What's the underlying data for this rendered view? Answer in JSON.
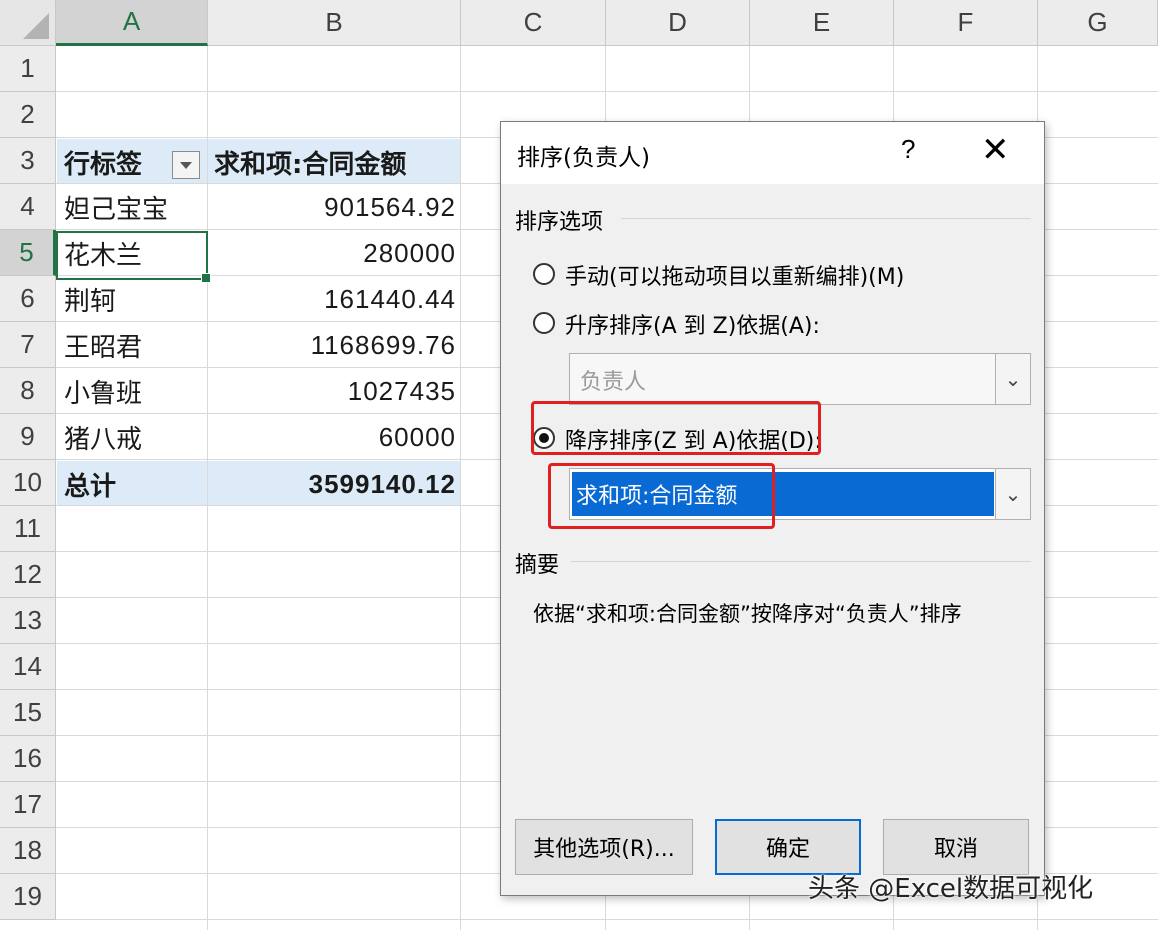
{
  "columns": [
    "A",
    "B",
    "C",
    "D",
    "E",
    "F",
    "G"
  ],
  "rows": [
    "1",
    "2",
    "3",
    "4",
    "5",
    "6",
    "7",
    "8",
    "9",
    "10",
    "11",
    "12",
    "13",
    "14",
    "15",
    "16",
    "17",
    "18",
    "19"
  ],
  "pivot": {
    "header_label": "行标签",
    "header_value": "求和项:合同金额",
    "items": [
      {
        "name": "妲己宝宝",
        "value": "901564.92"
      },
      {
        "name": "花木兰",
        "value": "280000"
      },
      {
        "name": "荆轲",
        "value": "161440.44"
      },
      {
        "name": "王昭君",
        "value": "1168699.76"
      },
      {
        "name": "小鲁班",
        "value": "1027435"
      },
      {
        "name": "猪八戒",
        "value": "60000"
      }
    ],
    "total_label": "总计",
    "total_value": "3599140.12"
  },
  "dialog": {
    "title": "排序(负责人)",
    "help": "?",
    "close": "✕",
    "section_options": "排序选项",
    "manual_label": "手动(可以拖动项目以重新编排)(M)",
    "ascending_label": "升序排序(A 到 Z)依据(A):",
    "ascending_value": "负责人",
    "descending_label": "降序排序(Z 到 A)依据(D):",
    "descending_value": "求和项:合同金额",
    "selected_option": "descending",
    "section_summary": "摘要",
    "summary_text": "依据“求和项:合同金额”按降序对“负责人”排序",
    "btn_more": "其他选项(R)...",
    "btn_ok": "确定",
    "btn_cancel": "取消"
  },
  "watermark": "头条 @Excel数据可视化",
  "colors": {
    "excel_green": "#217346",
    "selection_blue": "#0a6ad4",
    "highlight_red": "#e02020",
    "pivot_band": "#dcebf7"
  }
}
